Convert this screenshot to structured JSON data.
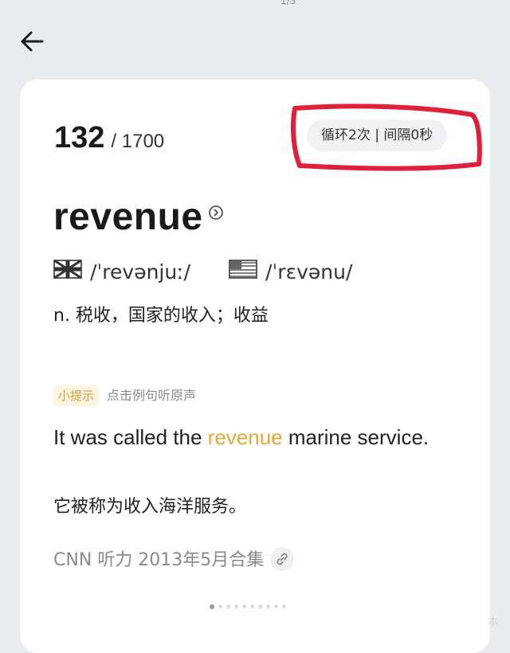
{
  "status": {
    "top_mark": "1/3"
  },
  "nav": {
    "back_icon": "arrow-left-icon"
  },
  "card": {
    "current_index": "132",
    "total": "/ 1700",
    "loop_setting": "循环2次 | 间隔0秒",
    "word": "revenue",
    "word_icon": "circle-chevron-right-icon",
    "phonetic_uk": "/ˈrevənjuː/",
    "phonetic_us": "/ˈrɛvənu/",
    "definition": "n. 税收，国家的收入；收益",
    "hint_tag": "小提示",
    "hint_text": "点击例句听原声",
    "sentence_before": "It was called the ",
    "sentence_highlight": "revenue",
    "sentence_after": " marine service.",
    "translation": "它被称为收入海洋服务。",
    "source": "CNN 听力 2013年5月合集",
    "link_icon": "link-icon",
    "page_dots_total": 10,
    "page_dots_active": 0
  },
  "colors": {
    "accent": "#f0b53a",
    "highlight_text": "#e4a934",
    "annotation_red": "#e0203a",
    "background": "#e9ecef",
    "card": "#ffffff"
  },
  "corner_mark": "本"
}
